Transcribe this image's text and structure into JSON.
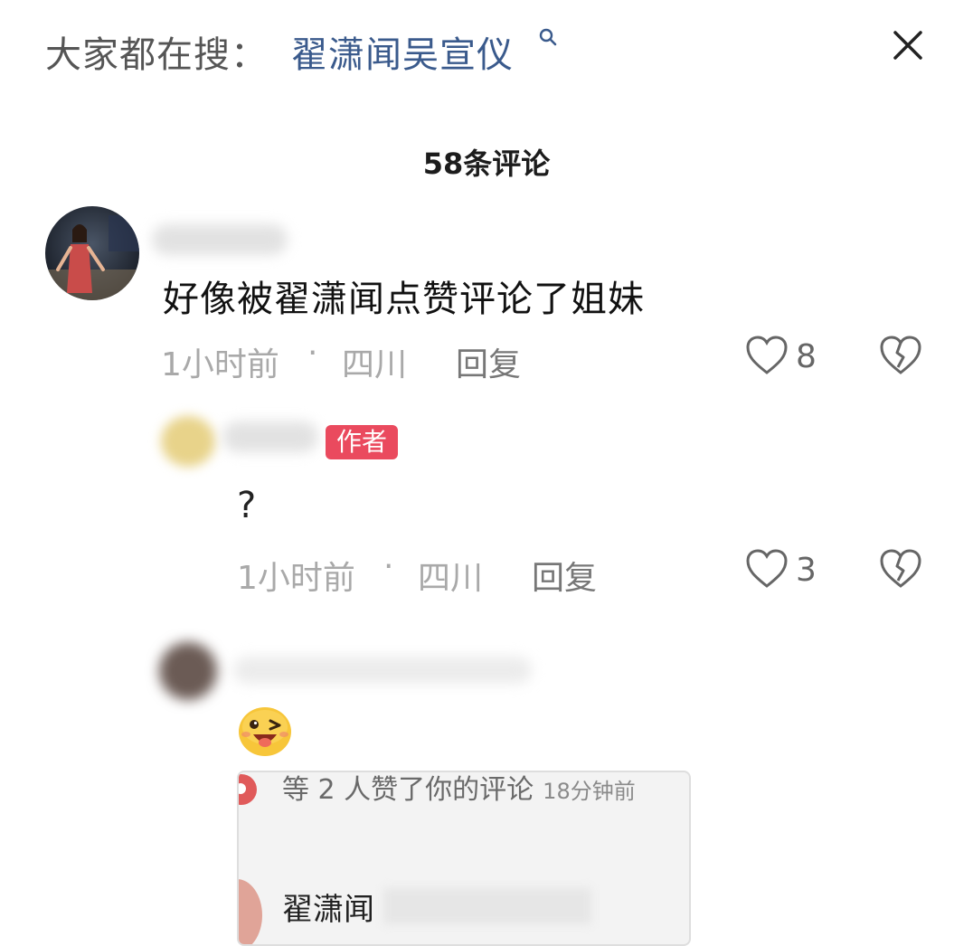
{
  "header": {
    "hot_label": "大家都在搜：",
    "hot_link": "翟潇闻吴宣仪",
    "search_icon": "search-icon",
    "close_icon": "close-icon"
  },
  "comments_count_title": "58条评论",
  "comments": [
    {
      "text": "好像被翟潇闻点赞评论了姐妹",
      "time": "1小时前",
      "dot": "·",
      "location": "四川",
      "reply_label": "回复",
      "likes": "8"
    },
    {
      "badge": "作者",
      "text": "?",
      "time": "1小时前",
      "dot": "·",
      "location": "四川",
      "reply_label": "回复",
      "likes": "3"
    },
    {
      "emoji": "😜",
      "card": {
        "line": "等 2 人赞了你的评论",
        "time": "18分钟前",
        "name": "翟潇闻"
      }
    }
  ],
  "colors": {
    "link": "#3a5a8c",
    "badge": "#ea4a5e",
    "meta": "#a9a9a9"
  }
}
